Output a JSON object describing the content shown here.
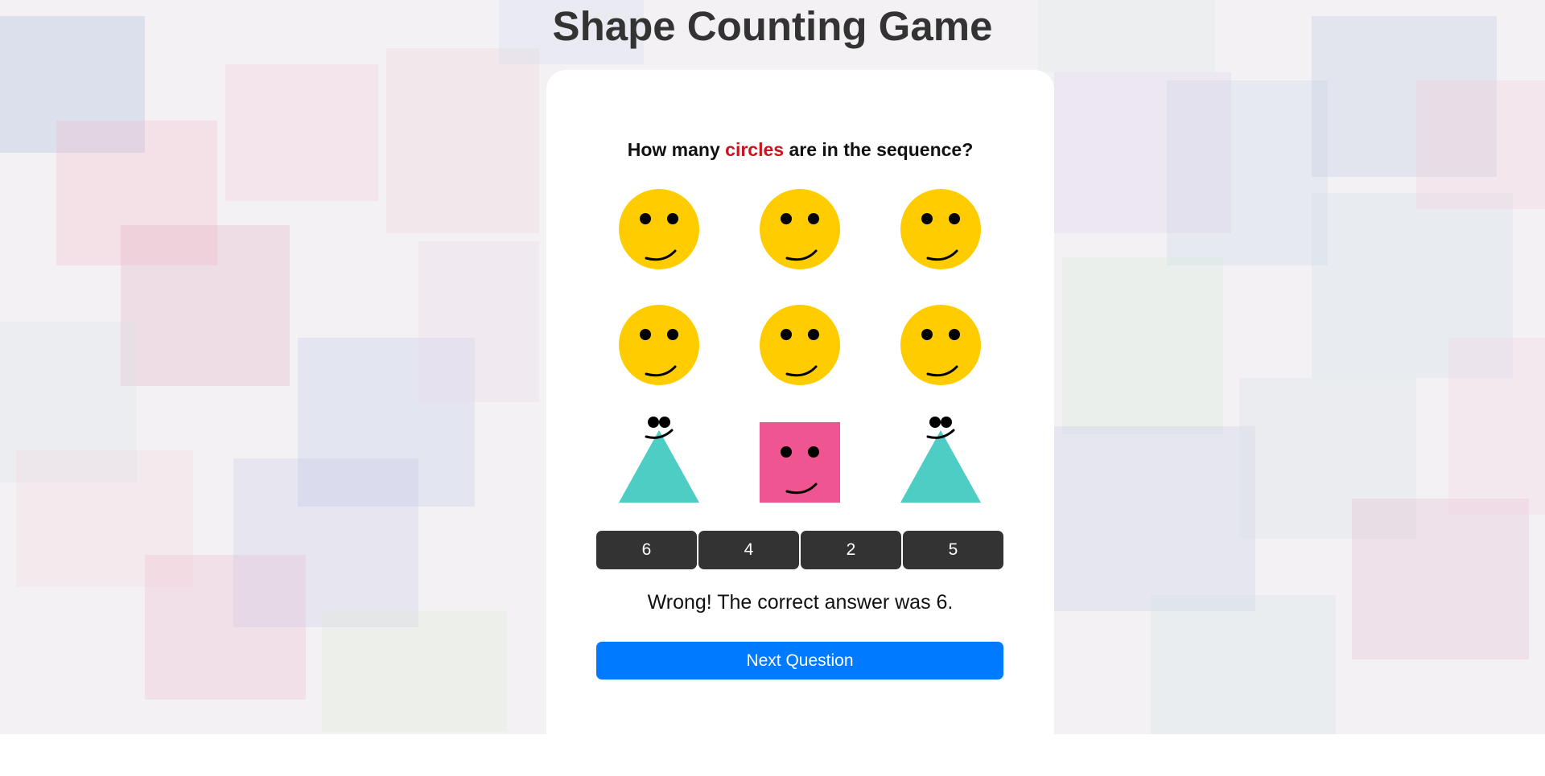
{
  "game": {
    "title": "Shape Counting Game",
    "question": {
      "prefix": "How many ",
      "target": "circles",
      "suffix": " are in the sequence?"
    },
    "shapes": [
      {
        "type": "circle",
        "color": "#ffcc00"
      },
      {
        "type": "circle",
        "color": "#ffcc00"
      },
      {
        "type": "circle",
        "color": "#ffcc00"
      },
      {
        "type": "circle",
        "color": "#ffcc00"
      },
      {
        "type": "circle",
        "color": "#ffcc00"
      },
      {
        "type": "circle",
        "color": "#ffcc00"
      },
      {
        "type": "triangle",
        "color": "#4ecdc4"
      },
      {
        "type": "square",
        "color": "#ee5591"
      },
      {
        "type": "triangle",
        "color": "#4ecdc4"
      }
    ],
    "answers": [
      "6",
      "4",
      "2",
      "5"
    ],
    "feedback": "Wrong! The correct answer was 6.",
    "next_button": "Next Question"
  },
  "colors": {
    "accent": "#007bff",
    "highlight": "#c8141e",
    "answer_button": "#333333",
    "title": "#333333"
  }
}
